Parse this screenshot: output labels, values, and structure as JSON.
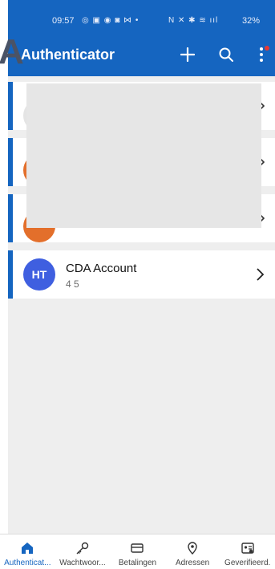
{
  "status_bar": {
    "time": "09:57",
    "left_icons": "◎ ▣ ◉ ◙ ⋈ •",
    "right_icons": "N ✕ ✱ ≋ ııl",
    "battery": "32%"
  },
  "header": {
    "title": "Authenticator",
    "add_icon": "plus-icon",
    "search_icon": "search-icon",
    "more_icon": "more-vertical-icon",
    "accent": "#1565c0"
  },
  "accounts": [
    {
      "name": "",
      "sub": ""
    },
    {
      "name": "",
      "sub": ""
    },
    {
      "name": "",
      "sub": ""
    },
    {
      "initials": "HT",
      "name": "CDA Account",
      "sub": "4      5",
      "avatar_color": "#3f5fe0"
    }
  ],
  "bottom_nav": {
    "items": [
      {
        "label": "Authenticat...",
        "icon": "home-icon",
        "active": true
      },
      {
        "label": "Wachtwoor...",
        "icon": "key-icon"
      },
      {
        "label": "Betalingen",
        "icon": "card-icon"
      },
      {
        "label": "Adressen",
        "icon": "location-icon"
      },
      {
        "label": "Geverifieerd.",
        "icon": "id-card-icon"
      }
    ]
  }
}
